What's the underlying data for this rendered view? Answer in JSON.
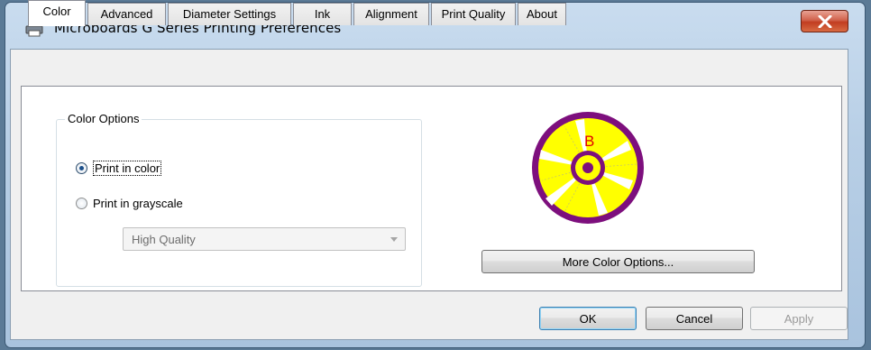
{
  "window": {
    "title": "Microboards G Series Printing Preferences"
  },
  "tabs": [
    {
      "label": "Color",
      "active": true
    },
    {
      "label": "Advanced"
    },
    {
      "label": "Diameter Settings"
    },
    {
      "label": "Ink"
    },
    {
      "label": "Alignment"
    },
    {
      "label": "Print Quality"
    },
    {
      "label": "About"
    }
  ],
  "color_options": {
    "group_label": "Color Options",
    "print_in_color": "Print in color",
    "print_in_grayscale": "Print in grayscale",
    "selected": "Print in color",
    "quality_select_value": "High Quality"
  },
  "preview": {
    "disc_letter": "B"
  },
  "more_color_options_label": "More Color Options...",
  "footer": {
    "ok_label": "OK",
    "cancel_label": "Cancel",
    "apply_label": "Apply"
  },
  "colors": {
    "disc_fill": "#ffff00",
    "disc_ring": "#7d0f7d",
    "letter": "#e00000"
  }
}
